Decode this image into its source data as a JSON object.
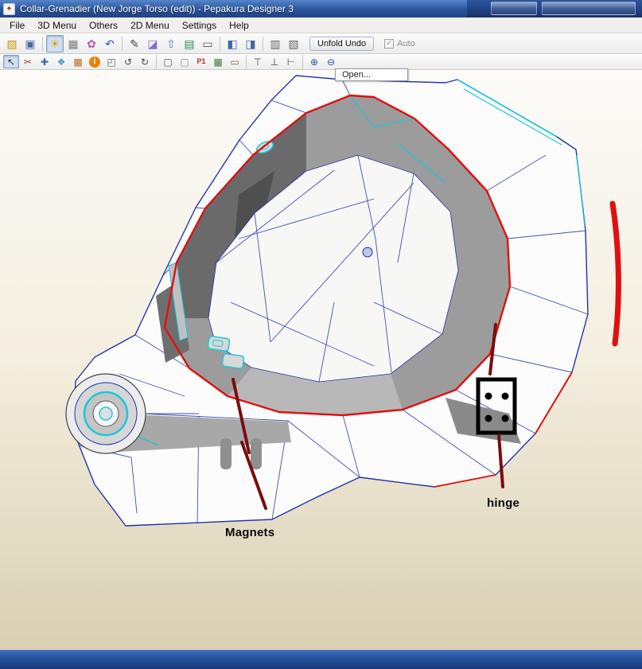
{
  "window": {
    "title": "Collar-Grenadier (New Jorge Torso (edit)) - Pepakura Designer 3"
  },
  "menu_bar": {
    "items": [
      "File",
      "3D Menu",
      "Others",
      "2D Menu",
      "Settings",
      "Help"
    ]
  },
  "toolbar_top": {
    "icons": [
      {
        "name": "open-icon",
        "glyph": "▨",
        "color": "#c8960c"
      },
      {
        "name": "save-icon",
        "glyph": "▣",
        "color": "#4466aa"
      },
      {
        "sep": true
      },
      {
        "name": "render-toggle-icon",
        "glyph": "☀",
        "color": "#e09a00",
        "pressed": true
      },
      {
        "name": "texture-view-icon",
        "glyph": "▦",
        "color": "#7a7a7a"
      },
      {
        "name": "material-palette-icon",
        "glyph": "✿",
        "color": "#b05ab0"
      },
      {
        "name": "undo-icon",
        "glyph": "↶",
        "color": "#2a56c6"
      },
      {
        "sep": true
      },
      {
        "name": "pen-icon",
        "glyph": "✎",
        "color": "#444444"
      },
      {
        "name": "eraser-icon",
        "glyph": "◪",
        "color": "#8a6ad0"
      },
      {
        "name": "arrow-up-icon",
        "glyph": "⇧",
        "color": "#3a78c2"
      },
      {
        "name": "export-page-icon",
        "glyph": "▤",
        "color": "#2e8b57"
      },
      {
        "name": "capture-icon",
        "glyph": "▭",
        "color": "#555555"
      },
      {
        "sep": true
      },
      {
        "name": "layout-3d-window-icon",
        "glyph": "◧",
        "color": "#4466aa"
      },
      {
        "name": "layout-2d-window-icon",
        "glyph": "◨",
        "color": "#4466aa"
      },
      {
        "sep": true
      },
      {
        "name": "print-layout-icon",
        "glyph": "▥",
        "color": "#666666"
      },
      {
        "name": "page-setup-icon",
        "glyph": "▧",
        "color": "#666666"
      }
    ],
    "unfold_undo_label": "Unfold Undo",
    "auto_label": "Auto",
    "auto_checked": true,
    "check_glyph": "✓"
  },
  "toolbar_second": {
    "icons": [
      {
        "name": "select-arrow-icon",
        "glyph": "↖",
        "color": "#333333",
        "pressed": true
      },
      {
        "name": "divide-edge-icon",
        "glyph": "✂",
        "color": "#aa3333"
      },
      {
        "name": "join-edge-icon",
        "glyph": "✚",
        "color": "#3366bb"
      },
      {
        "name": "paint-face-icon",
        "glyph": "❖",
        "color": "#2e9bd6"
      },
      {
        "name": "texture-stack-icon",
        "glyph": "▩",
        "color": "#c06a2a"
      },
      {
        "name": "info-icon",
        "glyph": "i",
        "color": "#ffffff",
        "bg": "#e8820c",
        "round": true
      },
      {
        "name": "box-part-icon",
        "glyph": "◰",
        "color": "#666666"
      },
      {
        "name": "rotate-left-icon",
        "glyph": "↺",
        "color": "#444444"
      },
      {
        "name": "rotate-right-icon",
        "glyph": "↻",
        "color": "#444444"
      },
      {
        "sep": true
      },
      {
        "name": "select-rect-icon",
        "glyph": "▢",
        "color": "#555555"
      },
      {
        "name": "select-part-icon",
        "glyph": "▢",
        "color": "#888888"
      },
      {
        "name": "part-number-icon",
        "glyph": "P1",
        "color": "#cc2222"
      },
      {
        "name": "grid-icon",
        "glyph": "▦",
        "color": "#3a7a3a"
      },
      {
        "name": "ruler-icon",
        "glyph": "▭",
        "color": "#8a5a2a"
      },
      {
        "sep": true
      },
      {
        "name": "align-top-icon",
        "glyph": "⊤",
        "color": "#444444"
      },
      {
        "name": "align-bottom-icon",
        "glyph": "⊥",
        "color": "#444444"
      },
      {
        "name": "align-left-icon",
        "glyph": "⊢",
        "color": "#444444"
      },
      {
        "sep": true
      },
      {
        "name": "zoom-in-icon",
        "glyph": "⊕",
        "color": "#2255aa"
      },
      {
        "name": "zoom-out-icon",
        "glyph": "⊖",
        "color": "#2255aa"
      }
    ]
  },
  "tooltip": {
    "text": "Open..."
  },
  "viewport": {
    "annotations": {
      "magnets": "Magnets",
      "hinge": "hinge"
    }
  },
  "colors": {
    "titlebar_blue": "#2f5fae",
    "taskbar_blue": "#27509b",
    "edge_navy": "#2233aa",
    "edge_cyan": "#1ac8dc",
    "edge_red": "#e01010",
    "annotation_dark_red": "#7a0d0d"
  }
}
